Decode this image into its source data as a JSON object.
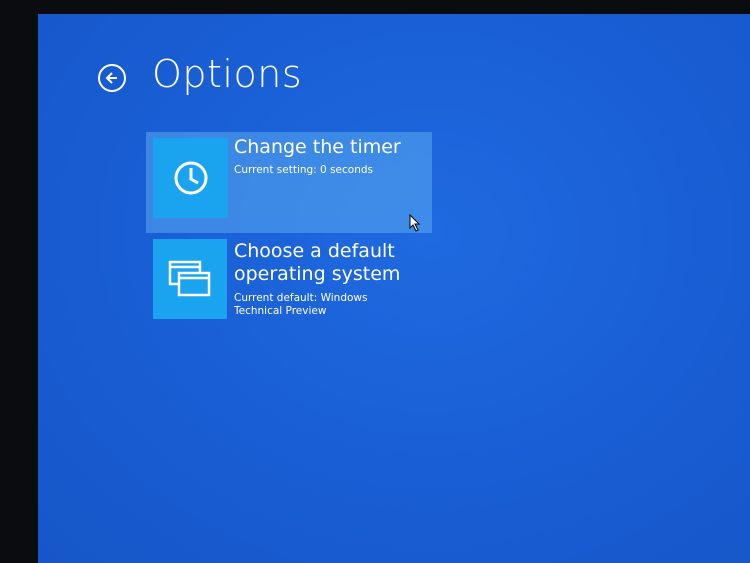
{
  "page": {
    "title": "Options"
  },
  "icons": {
    "back": "back-arrow-icon",
    "timer": "clock-icon",
    "default_os": "windows-stack-icon"
  },
  "options": [
    {
      "title": "Change the timer",
      "subtitle": "Current setting: 0 seconds",
      "selected": true
    },
    {
      "title": "Choose a default operating system",
      "subtitle": "Current default: Windows Technical Preview",
      "selected": false
    }
  ],
  "colors": {
    "background": "#1a5fd6",
    "tile_icon": "#1aa3ee",
    "tile_highlight": "#5aaaf0",
    "text": "#ffffff"
  }
}
